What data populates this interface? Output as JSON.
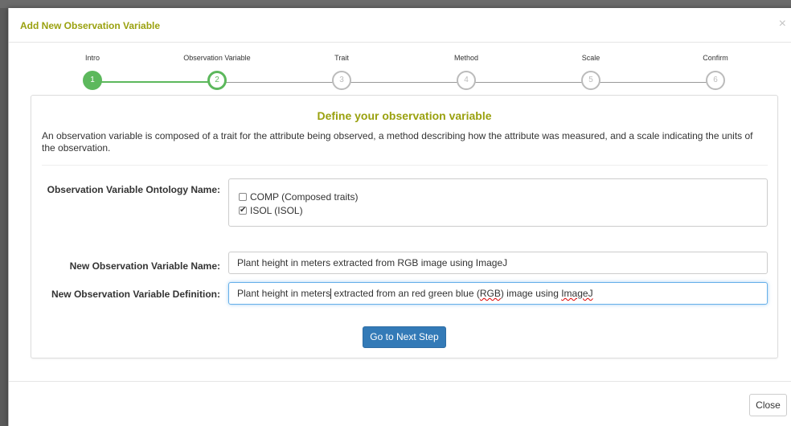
{
  "modal": {
    "title": "Add New Observation Variable",
    "close_symbol": "×"
  },
  "wizard": {
    "steps": [
      {
        "label": "Intro",
        "number": "1",
        "state": "done"
      },
      {
        "label": "Observation Variable",
        "number": "2",
        "state": "active"
      },
      {
        "label": "Trait",
        "number": "3",
        "state": "pending"
      },
      {
        "label": "Method",
        "number": "4",
        "state": "pending"
      },
      {
        "label": "Scale",
        "number": "5",
        "state": "pending"
      },
      {
        "label": "Confirm",
        "number": "6",
        "state": "pending"
      }
    ]
  },
  "panel": {
    "heading": "Define your observation variable",
    "description": "An observation variable is composed of a trait for the attribute being observed, a method describing how the attribute was measured, and a scale indicating the units of the observation."
  },
  "form": {
    "ontology_label": "Observation Variable Ontology Name:",
    "ontology_options": [
      {
        "label": "COMP (Composed traits)",
        "checked": false
      },
      {
        "label": "ISOL (ISOL)",
        "checked": true
      }
    ],
    "name_label": "New Observation Variable Name:",
    "name_value": "Plant height in meters extracted from RGB image using ImageJ",
    "definition_label": "New Observation Variable Definition:",
    "definition_value": {
      "before_caret": "Plant height in meters",
      "after_caret_1": " extracted from an red green blue (",
      "misspelled_1": "RGB",
      "after_caret_2": ") image using ",
      "misspelled_2": "ImageJ"
    },
    "next_button": "Go to Next Step"
  },
  "footer": {
    "close_button": "Close"
  },
  "colors": {
    "title_accent": "#9aa10f",
    "step_done": "#5cb85c",
    "primary": "#337ab7"
  }
}
